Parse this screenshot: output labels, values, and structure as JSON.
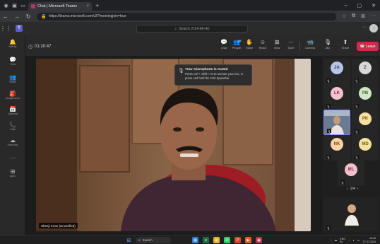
{
  "browser": {
    "tab_title": "Chat | Microsoft Teams",
    "url": "https://teams.microsoft.com/v2/?meetingjoin=true",
    "new_tab": "+"
  },
  "teams": {
    "search_placeholder": "Search (Ctrl+Alt+E)",
    "logo": "T"
  },
  "rail": [
    {
      "icon": "bell-icon",
      "glyph": "🔔",
      "label": "Activity"
    },
    {
      "icon": "chat-icon",
      "glyph": "💬",
      "label": "Chat"
    },
    {
      "icon": "teams-icon",
      "glyph": "👥",
      "label": "Teams"
    },
    {
      "icon": "assignments-icon",
      "glyph": "🎒",
      "label": "Assignments"
    },
    {
      "icon": "calendar-icon",
      "glyph": "📅",
      "label": "Calendar"
    },
    {
      "icon": "calls-icon",
      "glyph": "📞",
      "label": "Calls"
    },
    {
      "icon": "onedrive-icon",
      "glyph": "☁",
      "label": "OneDrive"
    },
    {
      "icon": "more-icon",
      "glyph": "···",
      "label": ""
    },
    {
      "icon": "apps-icon",
      "glyph": "⊞",
      "label": "Apps"
    }
  ],
  "meeting": {
    "elapsed": "01:20:47",
    "people_count": "15",
    "controls": [
      {
        "id": "chat",
        "glyph": "💬",
        "label": "Chat"
      },
      {
        "id": "people",
        "glyph": "👥",
        "label": "People"
      },
      {
        "id": "raise",
        "glyph": "✋",
        "label": "Raise"
      },
      {
        "id": "react",
        "glyph": "☺",
        "label": "React"
      },
      {
        "id": "view",
        "glyph": "⊞",
        "label": "View"
      },
      {
        "id": "more",
        "glyph": "···",
        "label": "More"
      },
      {
        "id": "camera",
        "glyph": "📹",
        "label": "Camera"
      },
      {
        "id": "mic",
        "glyph": "🎙",
        "label": "Mic"
      },
      {
        "id": "share",
        "glyph": "⬆",
        "label": "Share"
      }
    ],
    "leave_label": "Leave"
  },
  "stage": {
    "presenter_name": "Sheeji Kiran (Unverified)",
    "toast_title": "Your microphone is muted",
    "toast_body": "Press Ctrl + Shift + M to unmute your mic, or press and hold the Ctrl+Spacebar"
  },
  "participants": [
    {
      "initials": "JA",
      "bg": "#b7c4e6",
      "fg": "#2f3f78"
    },
    {
      "initials": "Z",
      "bg": "#d8d8d8",
      "fg": "#444444"
    },
    {
      "initials": "LK",
      "bg": "#f2c3cf",
      "fg": "#8d2841"
    },
    {
      "initials": "PB",
      "bg": "#cfe7c6",
      "fg": "#3b6b2d"
    },
    {
      "initials": "",
      "bg": "#6a7b91",
      "fg": "#ffffff",
      "video": true
    },
    {
      "initials": "PK",
      "bg": "#f7e0a1",
      "fg": "#7a5a09"
    },
    {
      "initials": "NK",
      "bg": "#f7d3a6",
      "fg": "#8a4b0e"
    },
    {
      "initials": "MD",
      "bg": "#f2e3a2",
      "fg": "#72600f"
    },
    {
      "initials": "ML",
      "bg": "#f2c0cc",
      "fg": "#8a2b45"
    }
  ],
  "pager": {
    "text": "1/4",
    "prev": "‹",
    "next": "›"
  },
  "taskbar": {
    "search_label": "Search",
    "time": "18:49",
    "date": "17-07-2024",
    "lang": "ENG\nIN"
  },
  "colors": {
    "leave": "#c4314b",
    "teams_brand": "#5b5fc7"
  }
}
